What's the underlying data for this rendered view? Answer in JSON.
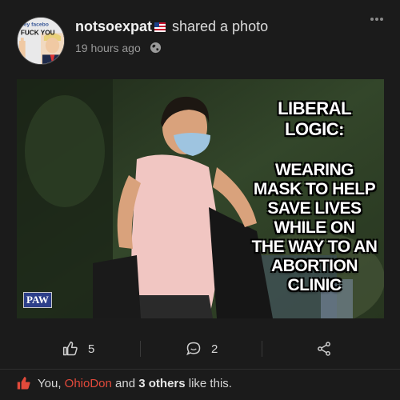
{
  "header": {
    "username": "notsoexpat",
    "action_text": "shared a photo",
    "timestamp": "19 hours ago",
    "avatar_text_line1": "Hey facebo",
    "avatar_text_line2": "FUCK YOU",
    "privacy_icon": "globe-icon",
    "flag_icon": "us-flag-icon",
    "menu_icon": "more-dots-icon"
  },
  "photo": {
    "meme_title": "LIBERAL LOGIC:",
    "meme_lines": [
      "WEARING",
      "MASK TO HELP",
      "SAVE LIVES",
      "WHILE ON",
      "THE WAY TO AN",
      "ABORTION CLINIC"
    ],
    "watermark": "PAW"
  },
  "actions": {
    "like_count": "5",
    "comment_count": "2",
    "like_icon": "thumbs-up-icon",
    "comment_icon": "comment-icon",
    "share_icon": "share-icon"
  },
  "likes_summary": {
    "prefix": "You, ",
    "name_link": "OhioDon",
    "middle": " and ",
    "others": "3 others",
    "suffix": " like this."
  },
  "colors": {
    "background": "#1b1b1b",
    "accent_red": "#e24a3b",
    "text": "#e6e6e6",
    "muted": "#9a9a9a"
  }
}
